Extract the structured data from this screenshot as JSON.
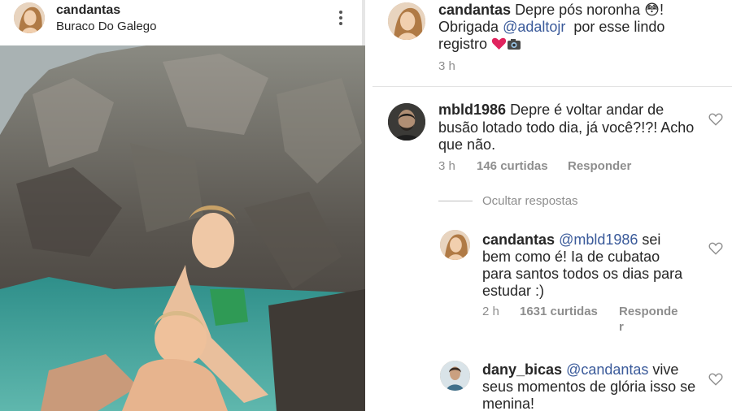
{
  "post": {
    "username": "candantas",
    "location": "Buraco Do Galego",
    "more_icon": "more-vertical-icon"
  },
  "caption": {
    "username": "candantas",
    "text_1": "Depre pós noronha ",
    "emoji_1": "😳",
    "text_2": "!",
    "text_3": "Obrigada ",
    "mention": "@adaltojr",
    "text_4": "  por esse lindo",
    "text_5": "registro ",
    "emoji_heart": "heart-emoji",
    "emoji_camera": "camera-emoji",
    "time": "3 h"
  },
  "comments": [
    {
      "username": "mbld1986",
      "lines": [
        "Depre é voltar andar de",
        "busão lotado todo dia, já você?!?! Acho",
        "que não."
      ],
      "time": "3 h",
      "likes": "146 curtidas",
      "reply": "Responder"
    }
  ],
  "hide_replies": "Ocultar respostas",
  "replies": [
    {
      "username": "candantas",
      "mention": "@mbld1986",
      "lines": [
        " sei",
        "bem como é! Ia de cubatao",
        "para santos todos os dias para",
        "estudar :)"
      ],
      "time": "2 h",
      "likes": "1631 curtidas",
      "reply_1": "Responde",
      "reply_2": "r"
    },
    {
      "username": "dany_bicas",
      "mention": "@candantas",
      "lines": [
        " vive",
        "seus momentos de glória isso se",
        "menina!"
      ]
    }
  ],
  "colors": {
    "mention": "#3a5a9a",
    "meta": "#8e8e8e",
    "heart_emoji": "#e0245e"
  }
}
